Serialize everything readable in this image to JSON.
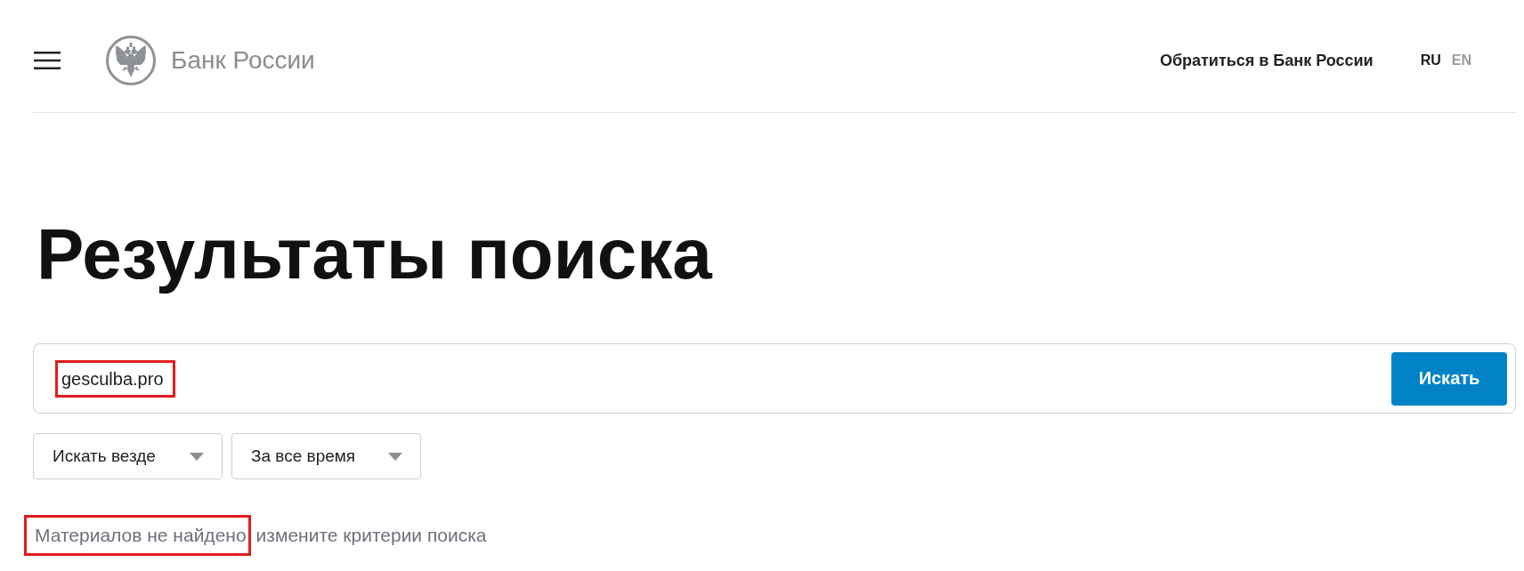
{
  "header": {
    "brand": "Банк России",
    "contact_link": "Обратиться в Банк России",
    "languages": [
      {
        "label": "RU",
        "selected": true
      },
      {
        "label": "EN",
        "selected": false
      }
    ]
  },
  "page_title": "Результаты поиска",
  "search": {
    "value": "gesculba.pro",
    "highlighted": true,
    "button": "Искать"
  },
  "filters": [
    {
      "label": "Искать везде"
    },
    {
      "label": "За все время"
    }
  ],
  "result_message": [
    {
      "text": "Материалов не найдено",
      "highlighted": true
    },
    {
      "text": "измените критерии поиска",
      "highlighted": false
    }
  ]
}
